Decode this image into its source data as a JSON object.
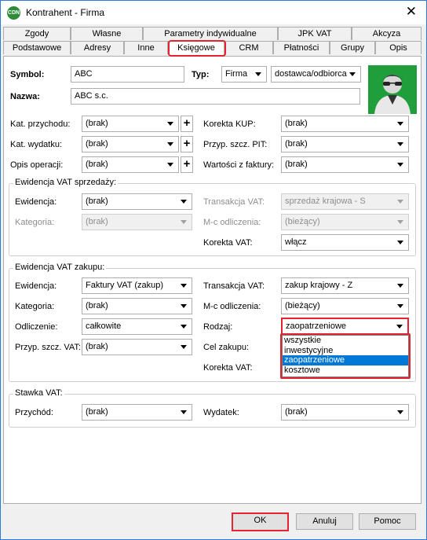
{
  "window": {
    "title": "Kontrahent - Firma",
    "app_icon": "cdn-icon"
  },
  "tabs": {
    "row1": [
      "Zgody",
      "Własne",
      "Parametry indywidualne",
      "JPK VAT",
      "Akcyza"
    ],
    "row2": [
      "Podstawowe",
      "Adresy",
      "Inne",
      "Księgowe",
      "CRM",
      "Płatności",
      "Grupy",
      "Opis"
    ],
    "active": "Księgowe"
  },
  "header": {
    "symbol_label": "Symbol:",
    "symbol_value": "ABC",
    "typ_label": "Typ:",
    "typ_value": "Firma",
    "rola_value": "dostawca/odbiorca",
    "nazwa_label": "Nazwa:",
    "nazwa_value": "ABC s.c."
  },
  "general": {
    "kat_przych_label": "Kat. przychodu:",
    "kat_przych_value": "(brak)",
    "kat_wyd_label": "Kat. wydatku:",
    "kat_wyd_value": "(brak)",
    "opis_label": "Opis operacji:",
    "opis_value": "(brak)",
    "korekta_kup_label": "Korekta KUP:",
    "korekta_kup_value": "(brak)",
    "przyp_pit_label": "Przyp. szcz. PIT:",
    "przyp_pit_value": "(brak)",
    "wartosci_label": "Wartości z faktury:",
    "wartosci_value": "(brak)"
  },
  "vat_sprzedaz": {
    "title": "Ewidencja VAT sprzedaży:",
    "ewidencja_label": "Ewidencja:",
    "ewidencja_value": "(brak)",
    "kategoria_label": "Kategoria:",
    "kategoria_value": "(brak)",
    "transakcja_label": "Transakcja VAT:",
    "transakcja_value": "sprzedaż krajowa - S",
    "mc_label": "M-c odliczenia:",
    "mc_value": "(bieżący)",
    "korekta_label": "Korekta VAT:",
    "korekta_value": "włącz"
  },
  "vat_zakup": {
    "title": "Ewidencja VAT zakupu:",
    "ewidencja_label": "Ewidencja:",
    "ewidencja_value": "Faktury VAT (zakup)",
    "kategoria_label": "Kategoria:",
    "kategoria_value": "(brak)",
    "odliczenie_label": "Odliczenie:",
    "odliczenie_value": "całkowite",
    "przyp_label": "Przyp. szcz. VAT:",
    "przyp_value": "(brak)",
    "transakcja_label": "Transakcja VAT:",
    "transakcja_value": "zakup krajowy - Z",
    "mc_label": "M-c odliczenia:",
    "mc_value": "(bieżący)",
    "rodzaj_label": "Rodzaj:",
    "rodzaj_value": "zaopatrzeniowe",
    "rodzaj_options": [
      "wszystkie",
      "inwestycyjne",
      "zaopatrzeniowe",
      "kosztowe"
    ],
    "rodzaj_selected_index": 2,
    "cel_label": "Cel zakupu:",
    "korekta_label": "Korekta VAT:"
  },
  "stawka": {
    "title": "Stawka VAT:",
    "przychod_label": "Przychód:",
    "przychod_value": "(brak)",
    "wydatek_label": "Wydatek:",
    "wydatek_value": "(brak)"
  },
  "buttons": {
    "ok": "OK",
    "anuluj": "Anuluj",
    "pomoc": "Pomoc"
  },
  "colors": {
    "highlight": "#e52330",
    "selection": "#0078d7",
    "avatar_bg": "#1f9e3b"
  }
}
